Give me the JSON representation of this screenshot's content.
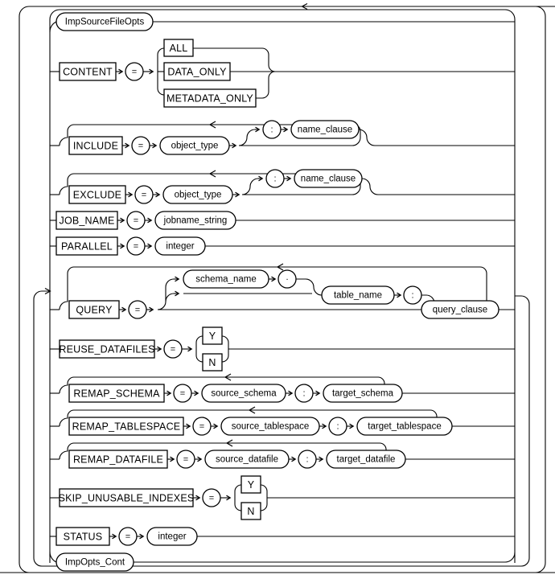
{
  "diagram": {
    "name": "ImpSourceFileOpts",
    "type": "railroad-syntax-diagram",
    "title": "ImpSourceFileOpts",
    "start_ref": "ImpSourceFileOpts",
    "end_ref": "ImpOpts_Cont",
    "operators": {
      "equals": "=",
      "colon": ":",
      "dot": "."
    },
    "colors": {
      "stroke": "#000000",
      "fill": "#ffffff",
      "background": "#ffffff"
    },
    "rows": [
      {
        "id": "row-start-ref",
        "kind": "ref",
        "label": "ImpSourceFileOpts"
      },
      {
        "id": "row-content",
        "kind": "keyword-choice",
        "keyword": "CONTENT",
        "operator": "=",
        "choices": [
          "ALL",
          "DATA_ONLY",
          "METADATA_ONLY"
        ]
      },
      {
        "id": "row-include",
        "kind": "keyword-optional-loop",
        "keyword": "INCLUDE",
        "operator": "=",
        "value": "object_type",
        "optional_operator": ":",
        "optional_value": "name_clause",
        "loop": true
      },
      {
        "id": "row-exclude",
        "kind": "keyword-optional-loop",
        "keyword": "EXCLUDE",
        "operator": "=",
        "value": "object_type",
        "optional_operator": ":",
        "optional_value": "name_clause",
        "loop": true
      },
      {
        "id": "row-job-name",
        "kind": "keyword-value",
        "keyword": "JOB_NAME",
        "operator": "=",
        "value": "jobname_string"
      },
      {
        "id": "row-parallel",
        "kind": "keyword-value",
        "keyword": "PARALLEL",
        "operator": "=",
        "value": "integer"
      },
      {
        "id": "row-query",
        "kind": "keyword-query",
        "keyword": "QUERY",
        "operator": "=",
        "schema_name": "schema_name",
        "dot": ".",
        "table_name": "table_name",
        "colon": ":",
        "query_clause": "query_clause",
        "loop": true
      },
      {
        "id": "row-reuse-datafiles",
        "kind": "keyword-yn",
        "keyword": "REUSE_DATAFILES",
        "operator": "=",
        "choices": [
          "Y",
          "N"
        ]
      },
      {
        "id": "row-remap-schema",
        "kind": "keyword-remap",
        "keyword": "REMAP_SCHEMA",
        "operator": "=",
        "source": "source_schema",
        "colon": ":",
        "target": "target_schema",
        "loop": true
      },
      {
        "id": "row-remap-tablespace",
        "kind": "keyword-remap",
        "keyword": "REMAP_TABLESPACE",
        "operator": "=",
        "source": "source_tablespace",
        "colon": ":",
        "target": "target_tablespace",
        "loop": true
      },
      {
        "id": "row-remap-datafile",
        "kind": "keyword-remap",
        "keyword": "REMAP_DATAFILE",
        "operator": "=",
        "source": "source_datafile",
        "colon": ":",
        "target": "target_datafile",
        "loop": true
      },
      {
        "id": "row-skip-unusable-indexes",
        "kind": "keyword-yn",
        "keyword": "SKIP_UNUSABLE_INDEXES",
        "operator": "=",
        "choices": [
          "Y",
          "N"
        ]
      },
      {
        "id": "row-status",
        "kind": "keyword-value",
        "keyword": "STATUS",
        "operator": "=",
        "value": "integer"
      },
      {
        "id": "row-end-ref",
        "kind": "ref",
        "label": "ImpOpts_Cont"
      }
    ]
  }
}
